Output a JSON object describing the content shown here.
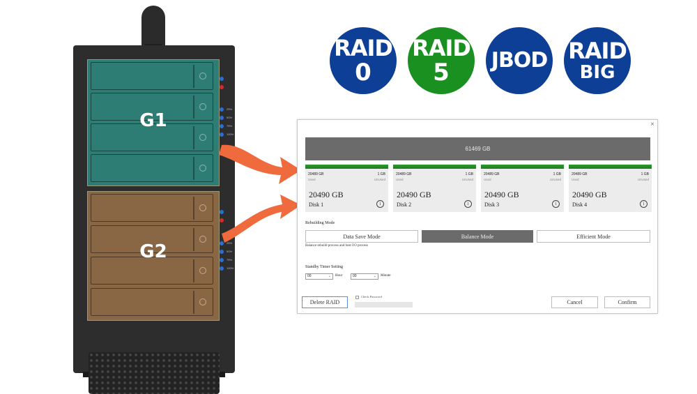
{
  "enclosure": {
    "groups": [
      {
        "label": "G1",
        "color": "#2e7d74"
      },
      {
        "label": "G2",
        "color": "#8a6744"
      }
    ],
    "led_labels_g1": [
      "",
      "",
      "25%",
      "50%",
      "75%",
      "100%"
    ],
    "led_labels_g2": [
      "",
      "",
      "25%",
      "50%",
      "75%",
      "100%"
    ]
  },
  "badges": [
    {
      "line1": "RAID",
      "line2": "0",
      "color": "#0d3f97"
    },
    {
      "line1": "RAID",
      "line2": "5",
      "color": "#19901f"
    },
    {
      "line1": "JBOD",
      "line2": "",
      "color": "#0d3f97"
    },
    {
      "line1": "RAID",
      "line2": "BIG",
      "color": "#0d3f97"
    }
  ],
  "dialog": {
    "close": "×",
    "pool_total": "61469 GB",
    "disks": [
      {
        "used": "20489 GB",
        "unused": "1 GB",
        "used_label": "Used",
        "unused_label": "UnUsed",
        "total": "20490 GB",
        "name": "Disk 1",
        "usage_fraction": 1.0
      },
      {
        "used": "20489 GB",
        "unused": "1 GB",
        "used_label": "Used",
        "unused_label": "UnUsed",
        "total": "20490 GB",
        "name": "Disk 2",
        "usage_fraction": 1.0
      },
      {
        "used": "20489 GB",
        "unused": "1 GB",
        "used_label": "Used",
        "unused_label": "UnUsed",
        "total": "20490 GB",
        "name": "Disk 3",
        "usage_fraction": 1.0
      },
      {
        "used": "20489 GB",
        "unused": "1 GB",
        "used_label": "Used",
        "unused_label": "UnUsed",
        "total": "20490 GB",
        "name": "Disk 4",
        "usage_fraction": 1.0
      }
    ],
    "info_glyph": "i",
    "rebuilding_label": "Rebuilding Mode",
    "modes": [
      "Data Save Mode",
      "Balance Mode",
      "Efficient Mode"
    ],
    "active_mode": "Balance Mode",
    "mode_description": "Balance rebuild process and host I/O process",
    "standby_label": "Standby Timer Setting",
    "hour_value": "00",
    "hour_unit": "Hour",
    "minute_value": "00",
    "minute_unit": "Minute",
    "delete_label": "Delete RAID",
    "check_password_label": "Check Password",
    "cancel_label": "Cancel",
    "confirm_label": "Confirm"
  },
  "colors": {
    "arrow": "#ef6a3d",
    "disk_bar": "#2f9b2f"
  }
}
